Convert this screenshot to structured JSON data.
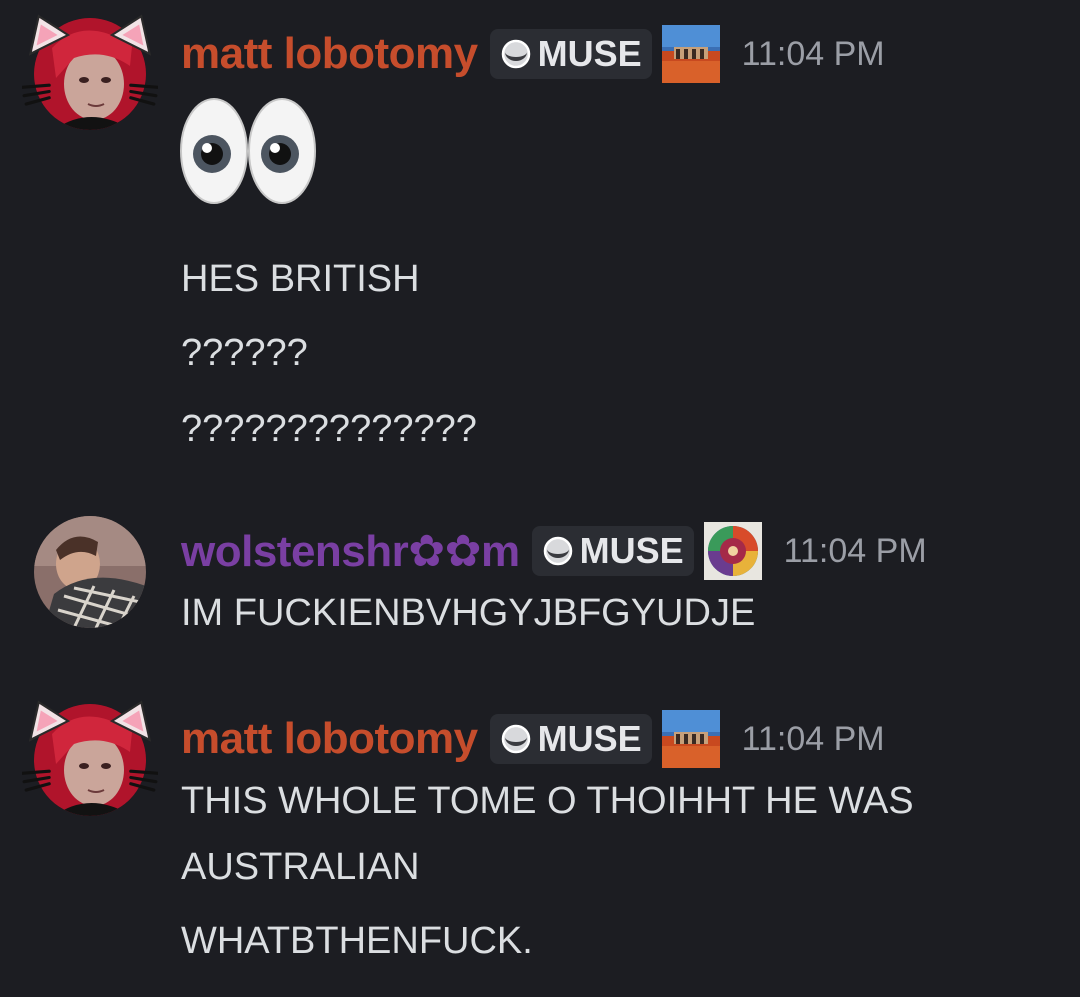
{
  "messages": [
    {
      "username": "matt lobotomy",
      "username_color": "#c64d2c",
      "tag_label": "MUSE",
      "timestamp": "11:04 PM",
      "avatar_icon": "red-haired-man-with-cat-ears-avatar",
      "album_icon": "red-desert-album-cover-icon",
      "emoji": "eyes-emoji",
      "lines": [
        "HES BRITISH",
        "??????",
        "??????????????"
      ]
    },
    {
      "username": "wolstenshr✿✿m",
      "username_color": "#7a3fa3",
      "tag_label": "MUSE",
      "timestamp": "11:04 PM",
      "avatar_icon": "man-with-blanket-avatar",
      "album_icon": "colorful-circle-album-cover-icon",
      "lines": [
        "IM FUCKIENBVHGYJBFGYUDJE"
      ]
    },
    {
      "username": "matt lobotomy",
      "username_color": "#c64d2c",
      "tag_label": "MUSE",
      "timestamp": "11:04 PM",
      "avatar_icon": "red-haired-man-with-cat-ears-avatar",
      "album_icon": "red-desert-album-cover-icon",
      "lines": [
        "THIS WHOLE TOME O THOIHHT HE WAS",
        "AUSTRALIAN",
        "WHATBTHENFUCK."
      ]
    }
  ],
  "colors": {
    "background": "#1c1d22",
    "text": "#dbdee1",
    "timestamp": "#9b9ea6",
    "tag_bg": "#2b2d33"
  }
}
